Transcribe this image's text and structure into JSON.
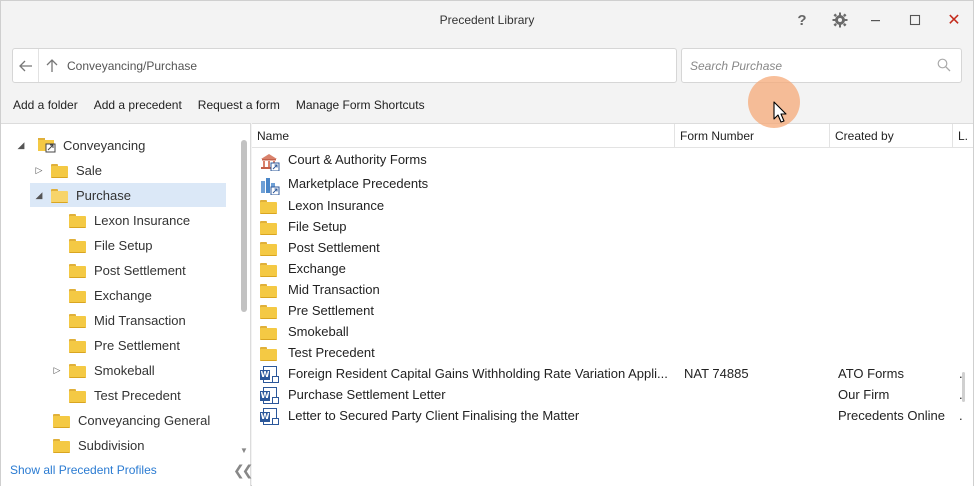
{
  "window": {
    "title": "Precedent Library"
  },
  "titlebar": {
    "help": "?",
    "close": "✕"
  },
  "nav": {
    "path": "Conveyancing/Purchase"
  },
  "search": {
    "placeholder": "Search Purchase"
  },
  "toolbar": {
    "add_folder": "Add a folder",
    "add_precedent": "Add a precedent",
    "request_form": "Request a form",
    "manage_shortcuts": "Manage Form Shortcuts"
  },
  "tree": {
    "root": "Conveyancing",
    "sale": "Sale",
    "purchase": "Purchase",
    "children": [
      "Lexon Insurance",
      "File Setup",
      "Post Settlement",
      "Exchange",
      "Mid Transaction",
      "Pre Settlement",
      "Smokeball",
      "Test Precedent"
    ],
    "conveyancing_general": "Conveyancing General",
    "subdivision": "Subdivision"
  },
  "left_footer": {
    "show_all": "Show all Precedent Profiles"
  },
  "table": {
    "columns": {
      "name": "Name",
      "form_number": "Form Number",
      "created_by": "Created by",
      "last": "L."
    },
    "rows": [
      {
        "name": "Court & Authority Forms",
        "form_number": "",
        "created_by": "",
        "last": "",
        "icon": "court-icon"
      },
      {
        "name": "Marketplace Precedents",
        "form_number": "",
        "created_by": "",
        "last": "",
        "icon": "marketplace-icon"
      },
      {
        "name": "Lexon Insurance",
        "form_number": "",
        "created_by": "",
        "last": "",
        "icon": "folder-icon"
      },
      {
        "name": "File Setup",
        "form_number": "",
        "created_by": "",
        "last": "",
        "icon": "folder-icon"
      },
      {
        "name": "Post Settlement",
        "form_number": "",
        "created_by": "",
        "last": "",
        "icon": "folder-icon"
      },
      {
        "name": "Exchange",
        "form_number": "",
        "created_by": "",
        "last": "",
        "icon": "folder-icon"
      },
      {
        "name": "Mid Transaction",
        "form_number": "",
        "created_by": "",
        "last": "",
        "icon": "folder-icon"
      },
      {
        "name": "Pre Settlement",
        "form_number": "",
        "created_by": "",
        "last": "",
        "icon": "folder-icon"
      },
      {
        "name": "Smokeball",
        "form_number": "",
        "created_by": "",
        "last": "",
        "icon": "folder-icon"
      },
      {
        "name": "Test Precedent",
        "form_number": "",
        "created_by": "",
        "last": "",
        "icon": "folder-icon"
      },
      {
        "name": "Foreign Resident Capital Gains Withholding Rate Variation Appli...",
        "form_number": "NAT 74885",
        "created_by": "ATO Forms",
        "last": ".",
        "icon": "word-doc-icon"
      },
      {
        "name": "Purchase Settlement Letter",
        "form_number": "",
        "created_by": "Our Firm",
        "last": ".",
        "icon": "word-doc-icon"
      },
      {
        "name": "Letter to Secured Party Client Finalising the Matter",
        "form_number": "",
        "created_by": "Precedents Online",
        "last": ".",
        "icon": "word-doc-icon"
      }
    ]
  },
  "colors": {
    "accent": "#2a7bd2",
    "selected_row": "#dbe8f7",
    "folder": "#f4c944",
    "word": "#2b579a",
    "close": "#c42b1c"
  }
}
